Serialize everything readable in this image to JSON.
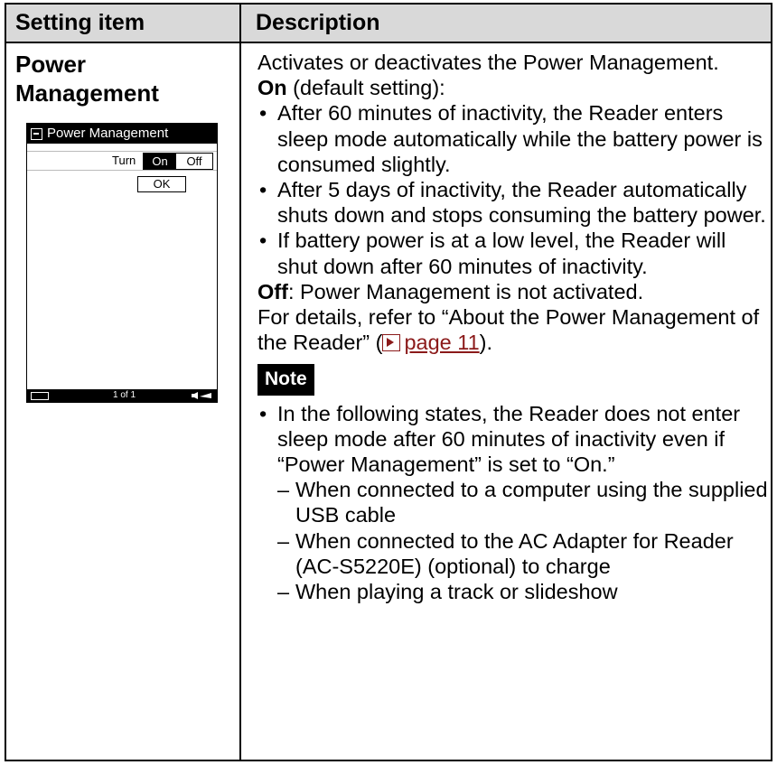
{
  "header": {
    "col1": "Setting item",
    "col2": "Description"
  },
  "item": {
    "line1": "Power",
    "line2": "Management"
  },
  "device": {
    "title": "Power Management",
    "turn_label": "Turn",
    "on_label": "On",
    "off_label": "Off",
    "ok_label": "OK",
    "page_indicator": "1 of 1"
  },
  "desc": {
    "intro": "Activates or deactivates the Power Management.",
    "on_bold": "On",
    "on_rest": " (default setting):",
    "bullets": [
      "After 60 minutes of inactivity, the Reader enters sleep mode automatically while the battery power is consumed slightly.",
      "After 5 days of inactivity, the Reader automatically shuts down and stops consuming the battery power.",
      "If battery power is at a low level, the Reader will shut down after 60 minutes of inactivity."
    ],
    "off_bold": "Off",
    "off_rest": ": Power Management is not activated.",
    "details_pre": "For details, refer to “About the Power Management of the Reader” (",
    "link_text": "page 11",
    "details_post": ").",
    "note_label": "Note",
    "note_bullet": "In the following states, the Reader does not enter sleep mode after 60 minutes of inactivity even if “Power Management” is set to “On.”",
    "note_subs": [
      "When connected to a computer using the supplied USB cable",
      "When connected to the AC Adapter for Reader (AC-S5220E) (optional) to charge",
      "When playing a track or slideshow"
    ]
  },
  "colors": {
    "header_bg": "#d9d9d9",
    "link": "#8b1a1a"
  }
}
